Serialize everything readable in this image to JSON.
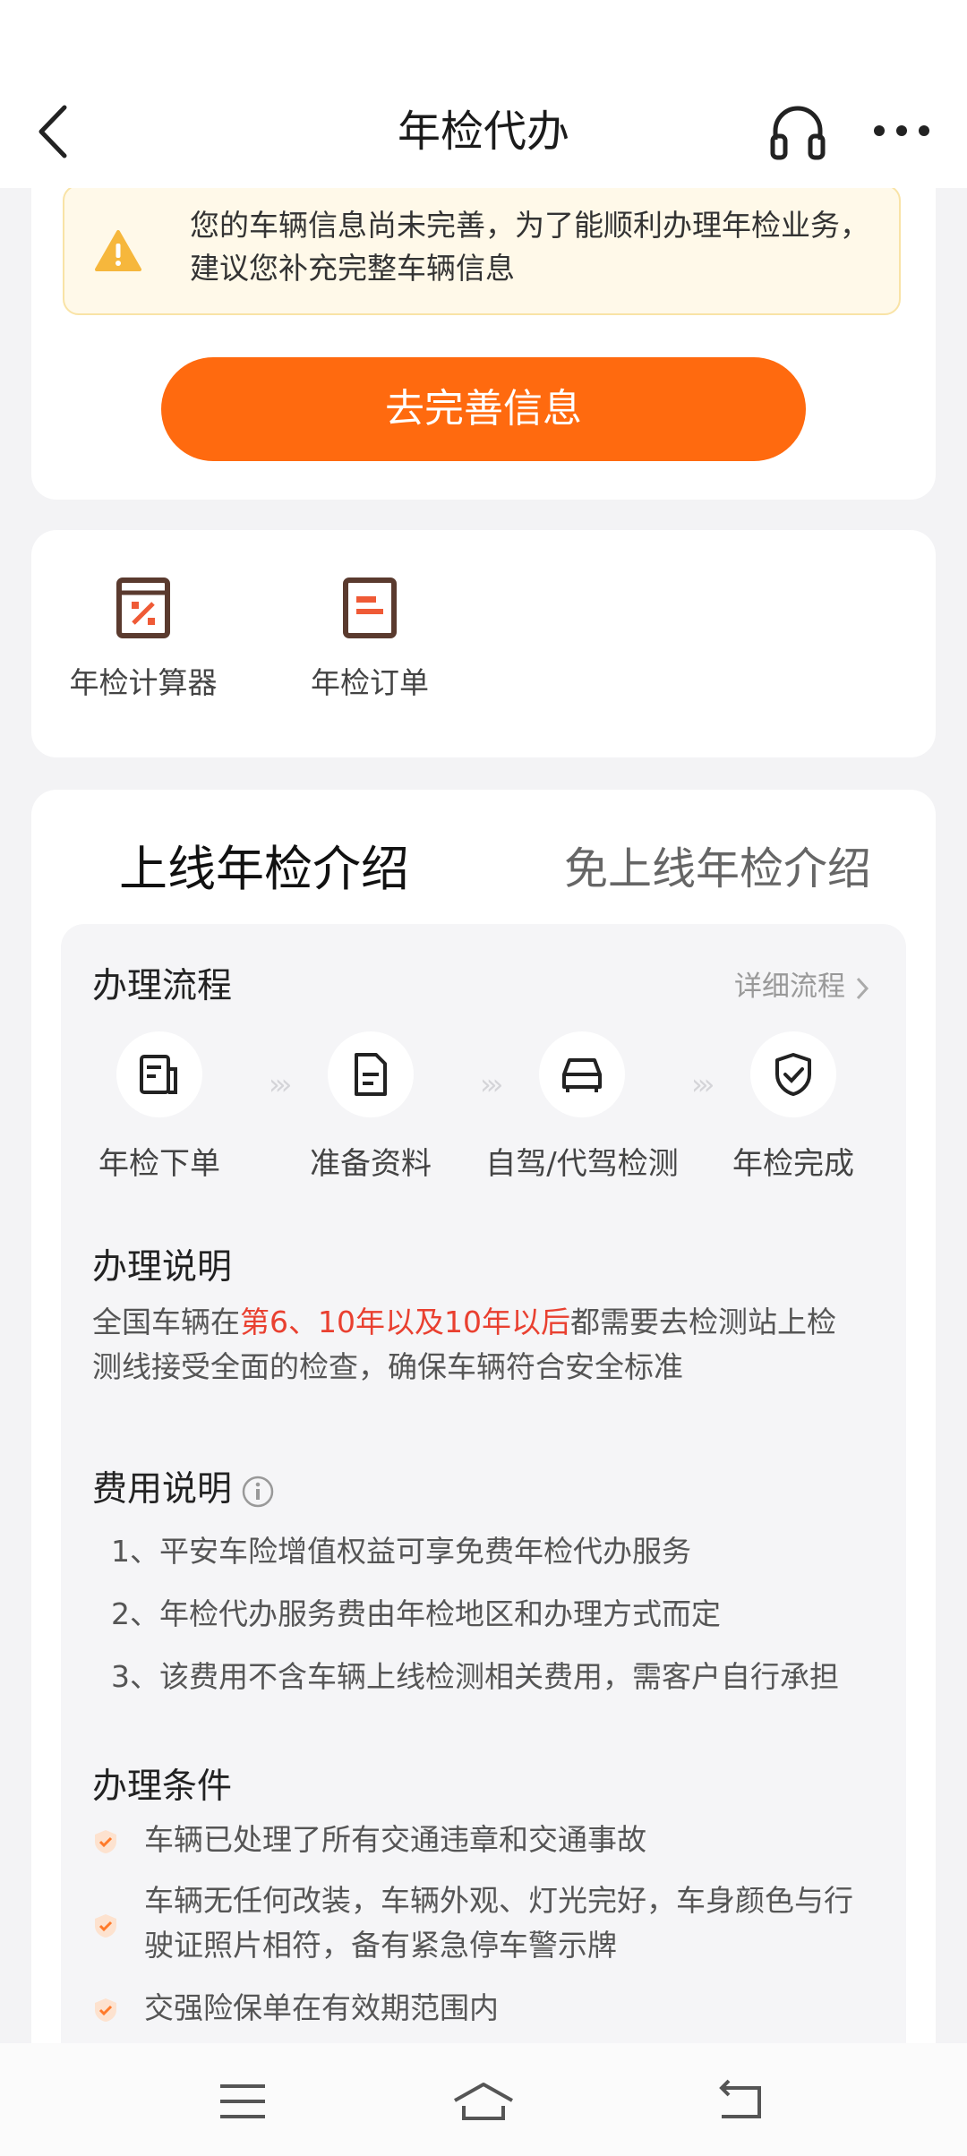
{
  "header": {
    "title": "年检代办"
  },
  "notice": {
    "text_line1": "您的车辆信息尚未完善，为了能顺利办理年检业务，",
    "text_line2": "建议您补充完整车辆信息",
    "button_label": "去完善信息"
  },
  "tools": [
    {
      "label": "年检计算器",
      "icon": "calculator-icon"
    },
    {
      "label": "年检订单",
      "icon": "order-icon"
    }
  ],
  "tabs": {
    "active": "上线年检介绍",
    "inactive": "免上线年检介绍"
  },
  "process": {
    "title": "办理流程",
    "detail_link": "详细流程",
    "steps": [
      {
        "label": "年检下单",
        "icon": "order-doc-icon"
      },
      {
        "label": "准备资料",
        "icon": "document-icon"
      },
      {
        "label": "自驾/代驾检测",
        "icon": "car-icon"
      },
      {
        "label": "年检完成",
        "icon": "shield-check-icon"
      }
    ],
    "arrow": "›››"
  },
  "description": {
    "title": "办理说明",
    "text_pre": "全国车辆在",
    "text_highlight": "第6、10年以及10年以后",
    "text_post1": "都需要去检测站上检",
    "text_line2": "测线接受全面的检查，确保车辆符合安全标准"
  },
  "fees": {
    "title": "费用说明",
    "items": [
      "1、平安车险增值权益可享免费年检代办服务",
      "2、年检代办服务费由年检地区和办理方式而定",
      "3、该费用不含车辆上线检测相关费用，需客户自行承担"
    ]
  },
  "conditions": {
    "title": "办理条件",
    "items": [
      "车辆已处理了所有交通违章和交通事故",
      "车辆无任何改装，车辆外观、灯光完好，车身颜色与行驶证照片相符，备有紧急停车警示牌",
      "交强险保单在有效期范围内"
    ]
  },
  "colors": {
    "accent": "#ff6a0f",
    "highlight": "#e94030",
    "warning_bg": "#fff9e9"
  }
}
